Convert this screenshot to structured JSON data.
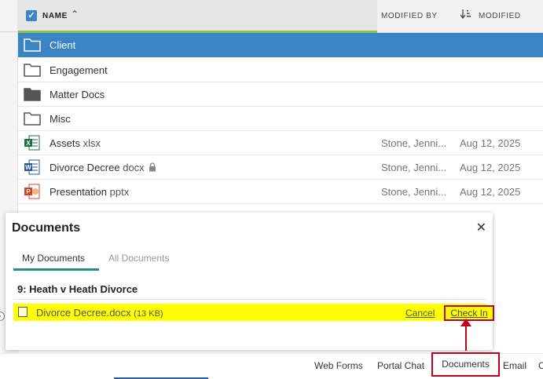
{
  "grid": {
    "header": {
      "name": "NAME",
      "modified_by": "MODIFIED BY",
      "modified": "MODIFIED"
    },
    "rows": [
      {
        "name": "Client",
        "ext": "",
        "icon": "folder-outline-icon",
        "modified_by": "",
        "modified": "",
        "selected": true
      },
      {
        "name": "Engagement",
        "ext": "",
        "icon": "folder-outline-icon",
        "modified_by": "",
        "modified": ""
      },
      {
        "name": "Matter Docs",
        "ext": "",
        "icon": "folder-filled-icon",
        "modified_by": "",
        "modified": ""
      },
      {
        "name": "Misc",
        "ext": "",
        "icon": "folder-outline-icon",
        "modified_by": "",
        "modified": ""
      },
      {
        "name": "Assets",
        "ext": "xlsx",
        "icon": "excel-file-icon",
        "modified_by": "Stone, Jenni...",
        "modified": "Aug 12, 2025"
      },
      {
        "name": "Divorce Decree",
        "ext": "docx",
        "icon": "word-file-icon",
        "modified_by": "Stone, Jenni...",
        "modified": "Aug 12, 2025",
        "locked": true
      },
      {
        "name": "Presentation",
        "ext": "pptx",
        "icon": "powerpoint-file-icon",
        "modified_by": "Stone, Jenni...",
        "modified": "Aug 12, 2025"
      }
    ]
  },
  "documents_panel": {
    "title": "Documents",
    "close_glyph": "✕",
    "tabs": {
      "my": "My Documents",
      "all": "All Documents"
    },
    "matter": "9: Heath v Heath Divorce",
    "item": {
      "name": "Divorce Decree.docx",
      "size": "(13 KB)",
      "cancel": "Cancel",
      "check_in": "Check In"
    }
  },
  "footer": {
    "web_forms": "Web Forms",
    "portal_chat": "Portal Chat",
    "documents": "Documents",
    "email": "Email",
    "more": "C"
  },
  "colors": {
    "selected_row": "#3b84c4",
    "highlight": "#ffff00",
    "annotation_red": "#c0001c",
    "tab_accent": "#2e8b7e"
  }
}
